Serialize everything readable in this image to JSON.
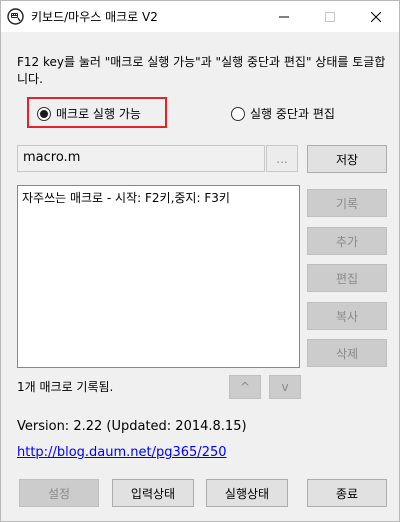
{
  "window": {
    "title": "키보드/마우스 매크로 V2",
    "app_icon": "keyboard-mouse-app-icon",
    "controls": [
      "minimize-icon",
      "maximize-icon",
      "close-icon"
    ]
  },
  "description": "F12 key를 눌러 \"매크로 실행 가능\"과 \"실행 중단과 편집\" 상태를 토글합니다.",
  "mode": {
    "options": [
      {
        "label": "매크로 실행 가능",
        "selected": true
      },
      {
        "label": "실행 중단과 편집",
        "selected": false
      }
    ],
    "highlight_color": "#e0242b"
  },
  "file": {
    "value": "macro.m",
    "browse_label": "...",
    "save_label": "저장"
  },
  "macro_list": {
    "items": [
      "자주쓰는 매크로 - 시작: F2키,중지: F3키"
    ]
  },
  "side_buttons": {
    "record": "기록",
    "add": "추가",
    "edit": "편집",
    "copy": "복사",
    "delete": "삭제"
  },
  "status": {
    "count_text": "1개 매크로 기록됨.",
    "up_label": "^",
    "down_label": "v"
  },
  "version_text": "Version: 2.22 (Updated: 2014.8.15)",
  "link_text": "http://blog.daum.net/pg365/250",
  "bottom_buttons": {
    "settings": "설정",
    "input_state": "입력상태",
    "run_state": "실행상태",
    "exit": "종료"
  }
}
